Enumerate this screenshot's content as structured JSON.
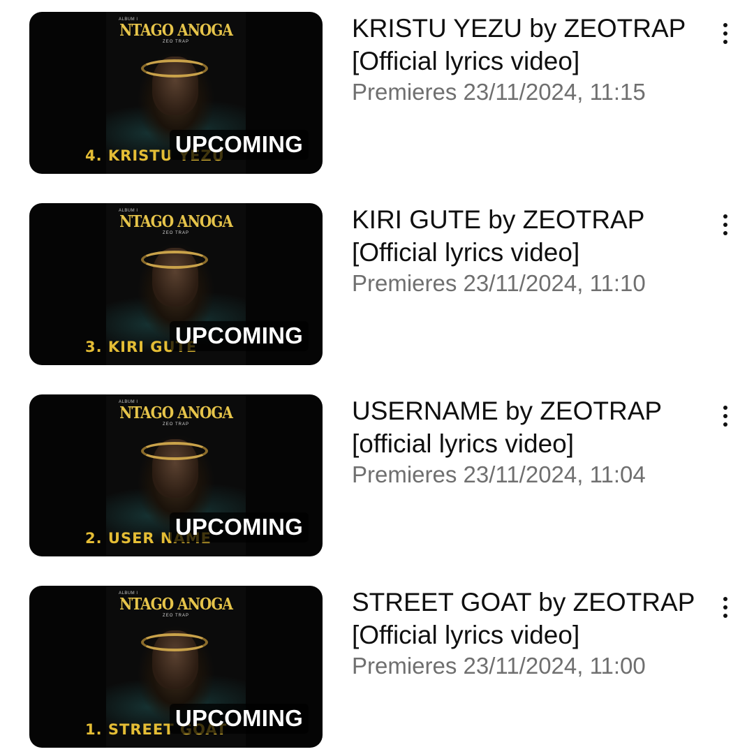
{
  "videos": [
    {
      "album_small": "ALBUM I",
      "album_title": "NTAGO ANOGA",
      "album_artist": "ZEO TRAP",
      "track_title": "4. KRISTU YEZU",
      "badge": "UPCOMING",
      "title_line1": "KRISTU YEZU by ZEOTRAP",
      "title_line2": "[Official lyrics video]",
      "meta": "Premieres 23/11/2024, 11:15"
    },
    {
      "album_small": "ALBUM I",
      "album_title": "NTAGO ANOGA",
      "album_artist": "ZEO TRAP",
      "track_title": "3. KIRI GUTE",
      "badge": "UPCOMING",
      "title_line1": "KIRI GUTE by ZEOTRAP",
      "title_line2": "[Official lyrics video]",
      "meta": "Premieres 23/11/2024, 11:10"
    },
    {
      "album_small": "ALBUM I",
      "album_title": "NTAGO ANOGA",
      "album_artist": "ZEO TRAP",
      "track_title": "2. USER NAME",
      "badge": "UPCOMING",
      "title_line1": "USERNAME by ZEOTRAP",
      "title_line2": "[official lyrics video]",
      "meta": "Premieres 23/11/2024, 11:04"
    },
    {
      "album_small": "ALBUM I",
      "album_title": "NTAGO ANOGA",
      "album_artist": "ZEO TRAP",
      "track_title": "1. STREET GOAT",
      "badge": "UPCOMING",
      "title_line1": "STREET GOAT by ZEOTRAP",
      "title_line2": "[Official lyrics video]",
      "meta": "Premieres 23/11/2024, 11:00"
    }
  ],
  "icons": {
    "menu": "more-vert-icon"
  },
  "colors": {
    "title_text": "#0f0f0f",
    "meta_text": "#6f6f6f",
    "album_gold": "#e6c44a",
    "badge_bg": "#000000"
  }
}
